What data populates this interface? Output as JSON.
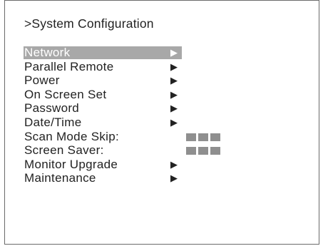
{
  "title": ">System Configuration",
  "menu": {
    "items": [
      {
        "label": "Network",
        "arrow": "▶"
      },
      {
        "label": "Parallel Remote",
        "arrow": "▶"
      },
      {
        "label": "Power",
        "arrow": "▶"
      },
      {
        "label": "On Screen Set",
        "arrow": "▶"
      },
      {
        "label": "Password",
        "arrow": "▶"
      },
      {
        "label": "Date/Time",
        "arrow": "▶"
      },
      {
        "label": "Scan Mode Skip:"
      },
      {
        "label": "Screen Saver:"
      },
      {
        "label": "Monitor Upgrade",
        "arrow": "▶"
      },
      {
        "label": "Maintenance",
        "arrow": "▶"
      }
    ],
    "selected_index": 0
  },
  "colors": {
    "highlight": "#a8a8a8",
    "text": "#222222",
    "value_block": "#8f8f8f"
  }
}
